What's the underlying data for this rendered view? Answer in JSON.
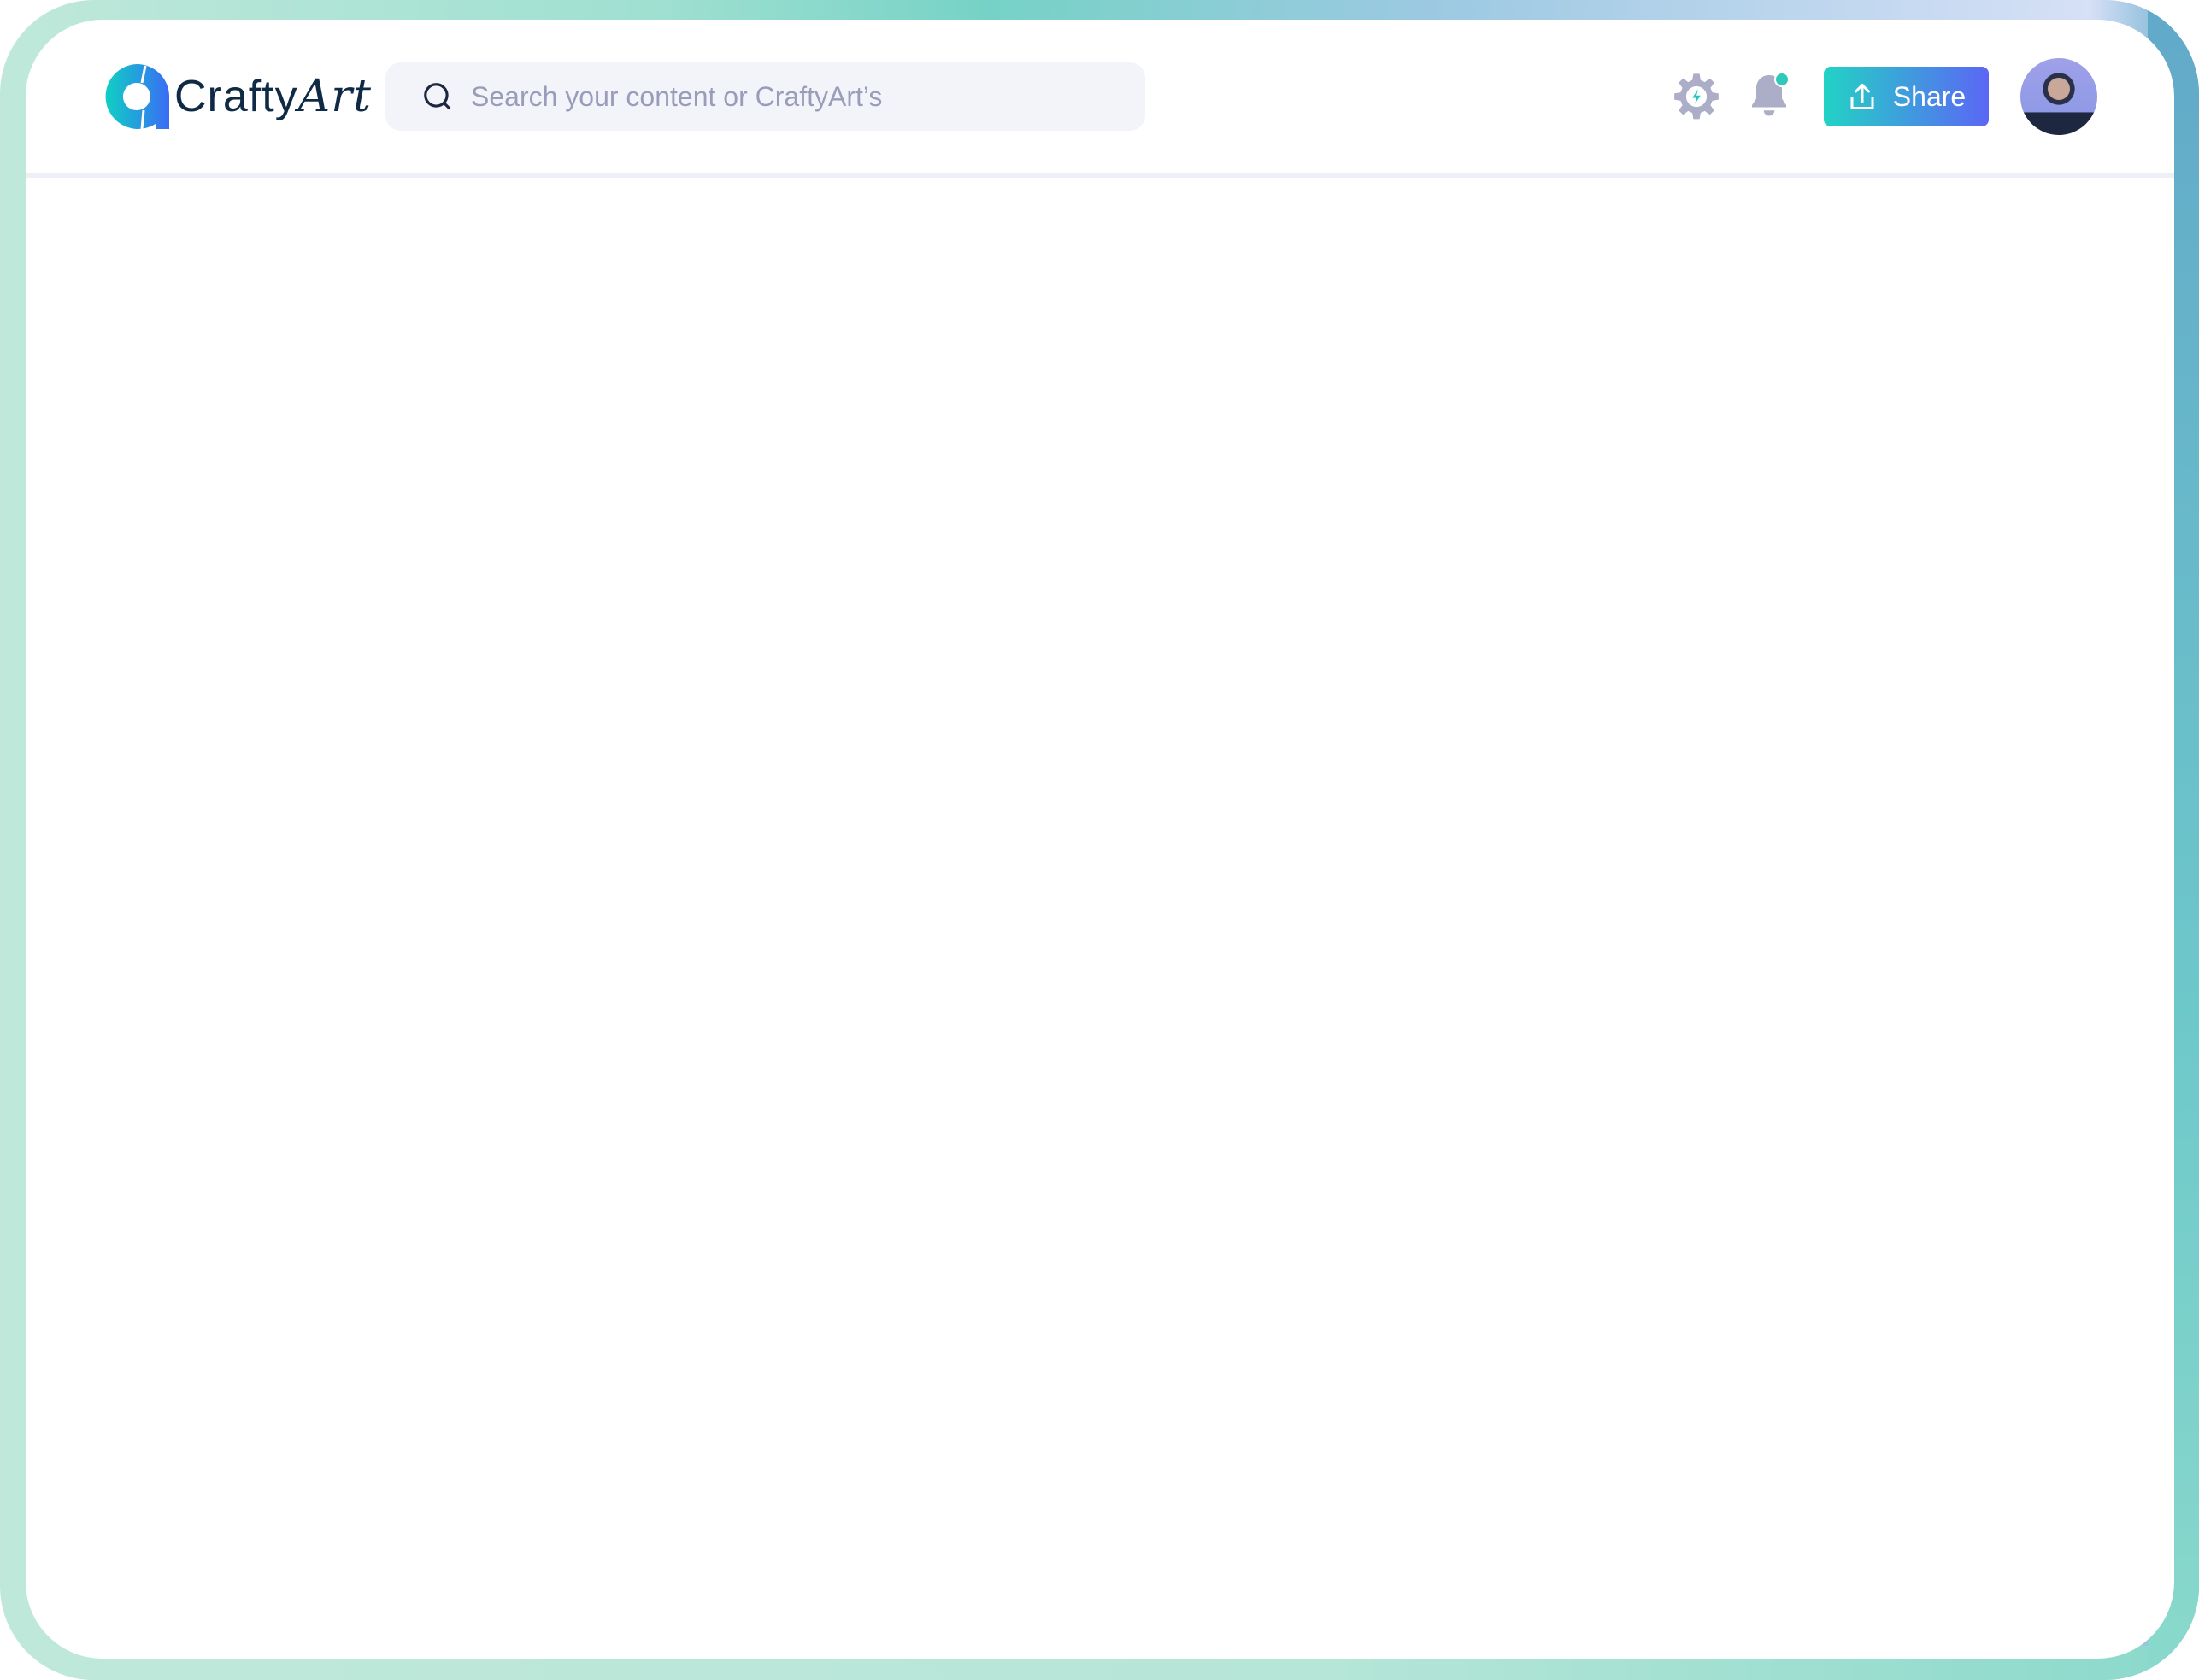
{
  "header": {
    "logo_text_plain": "Crafty",
    "logo_text_script": "Art",
    "search_placeholder": "Search your content or CraftyArt’s",
    "share_label": "Share",
    "icons": [
      "settings-icon",
      "notification-bell-icon",
      "upload-icon",
      "search-icon"
    ],
    "notification_dot_color": "#2ec9b8"
  },
  "colors": {
    "accent_start": "#22d3c5",
    "accent_end": "#5b66f5",
    "text_dark": "#0f2a45",
    "icon_gray": "#abaec6"
  }
}
